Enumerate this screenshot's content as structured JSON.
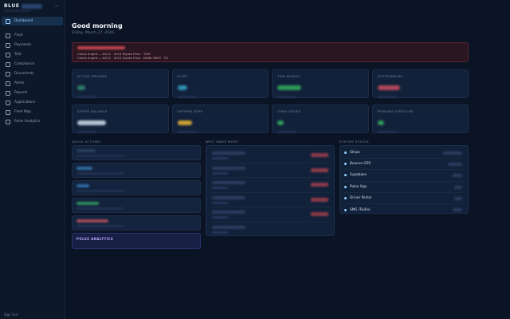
{
  "brand": {
    "name": "BLUE"
  },
  "sidebar": {
    "items": [
      {
        "label": "Dashboard",
        "icon": "home-icon"
      },
      {
        "label": "Fleet",
        "icon": "car-icon"
      },
      {
        "label": "Payments",
        "icon": "card-icon"
      },
      {
        "label": "Tolls",
        "icon": "toll-icon"
      },
      {
        "label": "Compliance",
        "icon": "check-icon"
      },
      {
        "label": "Documents",
        "icon": "document-icon"
      },
      {
        "label": "Alerts",
        "icon": "bell-icon"
      },
      {
        "label": "Reports",
        "icon": "chart-icon"
      },
      {
        "label": "Applications",
        "icon": "inbox-icon"
      },
      {
        "label": "Fleet Map",
        "icon": "map-icon"
      },
      {
        "label": "Pulse Analytics",
        "icon": "pulse-icon"
      }
    ],
    "footer": "Sign Out"
  },
  "header": {
    "greeting": "Good morning",
    "date": "Friday, March 27, 2026"
  },
  "alert": {
    "lines": [
      "Check engine — BC11 · 2010 Toyota Prius · TOM",
      "Check engine — BC11 · 2010 Toyota Prius · DARK GREY · TG"
    ]
  },
  "cards_row1": [
    {
      "label": "ACTIVE DRIVERS",
      "color": "#2e7a6a"
    },
    {
      "label": "FLEET",
      "color": "#2f8fb0"
    },
    {
      "label": "THIS MONTH",
      "color": "#2f9a5a"
    },
    {
      "label": "OUTSTANDING",
      "color": "#b0475a"
    }
  ],
  "cards_row2": [
    {
      "label": "STRIPE BALANCE",
      "color": "#b8c4d6"
    },
    {
      "label": "EXPIRED DATE",
      "color": "#c8a032"
    },
    {
      "label": "OPEN ISSUES",
      "color": "#2f9a5a"
    },
    {
      "label": "PENDING SPEED INS",
      "color": "#2f9a5a"
    }
  ],
  "sections": {
    "quick": "QUICK ACTIONS",
    "owes": "WHO OWES MOST",
    "status": "SYSTEM STATUS"
  },
  "quick_actions": [
    {
      "color": "#2b3d5e"
    },
    {
      "color": "#2f6aa0"
    },
    {
      "color": "#2f6aa0"
    },
    {
      "color": "#2f8a5a"
    },
    {
      "color": "#a04a58"
    }
  ],
  "pulse": {
    "label": "PULSE ANALYTICS"
  },
  "system_status": [
    {
      "name": "Stripe",
      "w": 24
    },
    {
      "name": "Bounce GPS",
      "w": 18
    },
    {
      "name": "Supabase",
      "w": 12
    },
    {
      "name": "Pulse App",
      "w": 10
    },
    {
      "name": "Driver Portal",
      "w": 10
    },
    {
      "name": "SMS (Twilio)",
      "w": 12
    }
  ]
}
